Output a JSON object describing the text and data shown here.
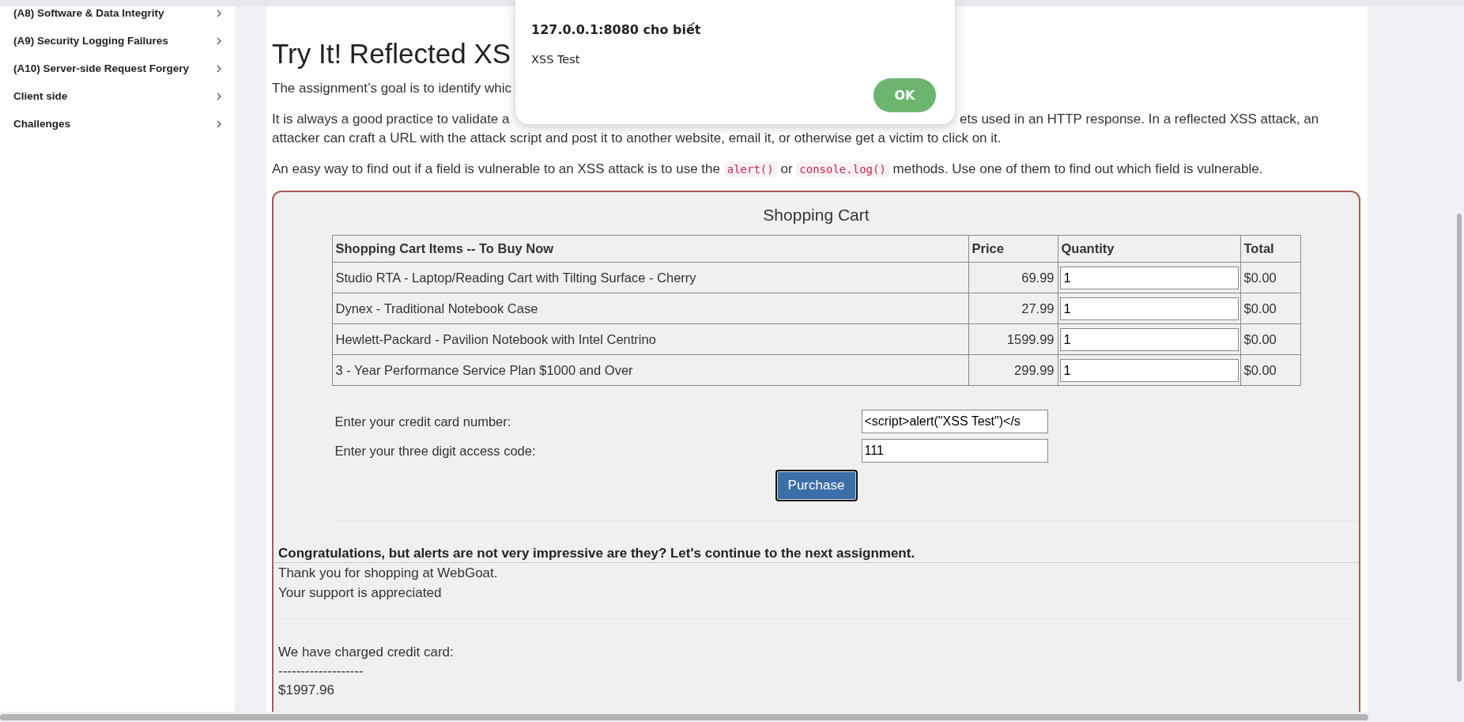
{
  "sidebar": {
    "items": [
      {
        "label": "(A8) Software & Data Integrity"
      },
      {
        "label": "(A9) Security Logging Failures"
      },
      {
        "label": "(A10) Server-side Request Forgery"
      },
      {
        "label": "Client side"
      },
      {
        "label": "Challenges"
      }
    ]
  },
  "lesson": {
    "heading": "Try It! Reflected XS",
    "lead": "The assignment’s goal is to identify whic",
    "practice": {
      "line_1_left": "It is always a good practice to validate a",
      "line_1_right": "ets used in an HTTP response. In a reflected XSS attack, an",
      "line_2": "attacker can craft a URL with the attack script and post it to another website, email it, or otherwise get a victim to click on it."
    },
    "hint": [
      {
        "kind": "text",
        "text": "An easy way to find out if a field is vulnerable to an XSS attack is to use the "
      },
      {
        "kind": "code",
        "text": "alert()"
      },
      {
        "kind": "text",
        "text": " or "
      },
      {
        "kind": "code",
        "text": "console.log()"
      },
      {
        "kind": "text",
        "text": " methods. Use one of them to find out which field is vulnerable."
      }
    ]
  },
  "cart": {
    "title": "Shopping Cart",
    "columns": [
      "Shopping Cart Items -- To Buy Now",
      "Price",
      "Quantity",
      "Total"
    ],
    "rows": [
      {
        "item": "Studio RTA - Laptop/Reading Cart with Tilting Surface - Cherry",
        "price": "69.99",
        "quantity": "1",
        "total": "$0.00"
      },
      {
        "item": "Dynex - Traditional Notebook Case",
        "price": "27.99",
        "quantity": "1",
        "total": "$0.00"
      },
      {
        "item": "Hewlett-Packard - Pavilion Notebook with Intel Centrino",
        "price": "1599.99",
        "quantity": "1",
        "total": "$0.00"
      },
      {
        "item": "3 - Year Performance Service Plan $1000 and Over",
        "price": "299.99",
        "quantity": "1",
        "total": "$0.00"
      }
    ],
    "fields": [
      {
        "label": "Enter your credit card number:",
        "value": "<script>alert(\"XSS Test\")</s"
      },
      {
        "label": "Enter your three digit access code:",
        "value": "111"
      }
    ],
    "button": "Purchase"
  },
  "result": {
    "feedback": "Congratulations, but alerts are not very impressive are they? Let's continue to the next assignment.",
    "messages": [
      "Thank you for shopping at WebGoat.",
      "Your support is appreciated"
    ],
    "output": [
      "We have charged credit card:",
      "-------------------",
      "$1997.96"
    ]
  },
  "dialog": {
    "title": "127.0.0.1:8080 cho biết",
    "message": "XSS Test",
    "button": "OK"
  }
}
